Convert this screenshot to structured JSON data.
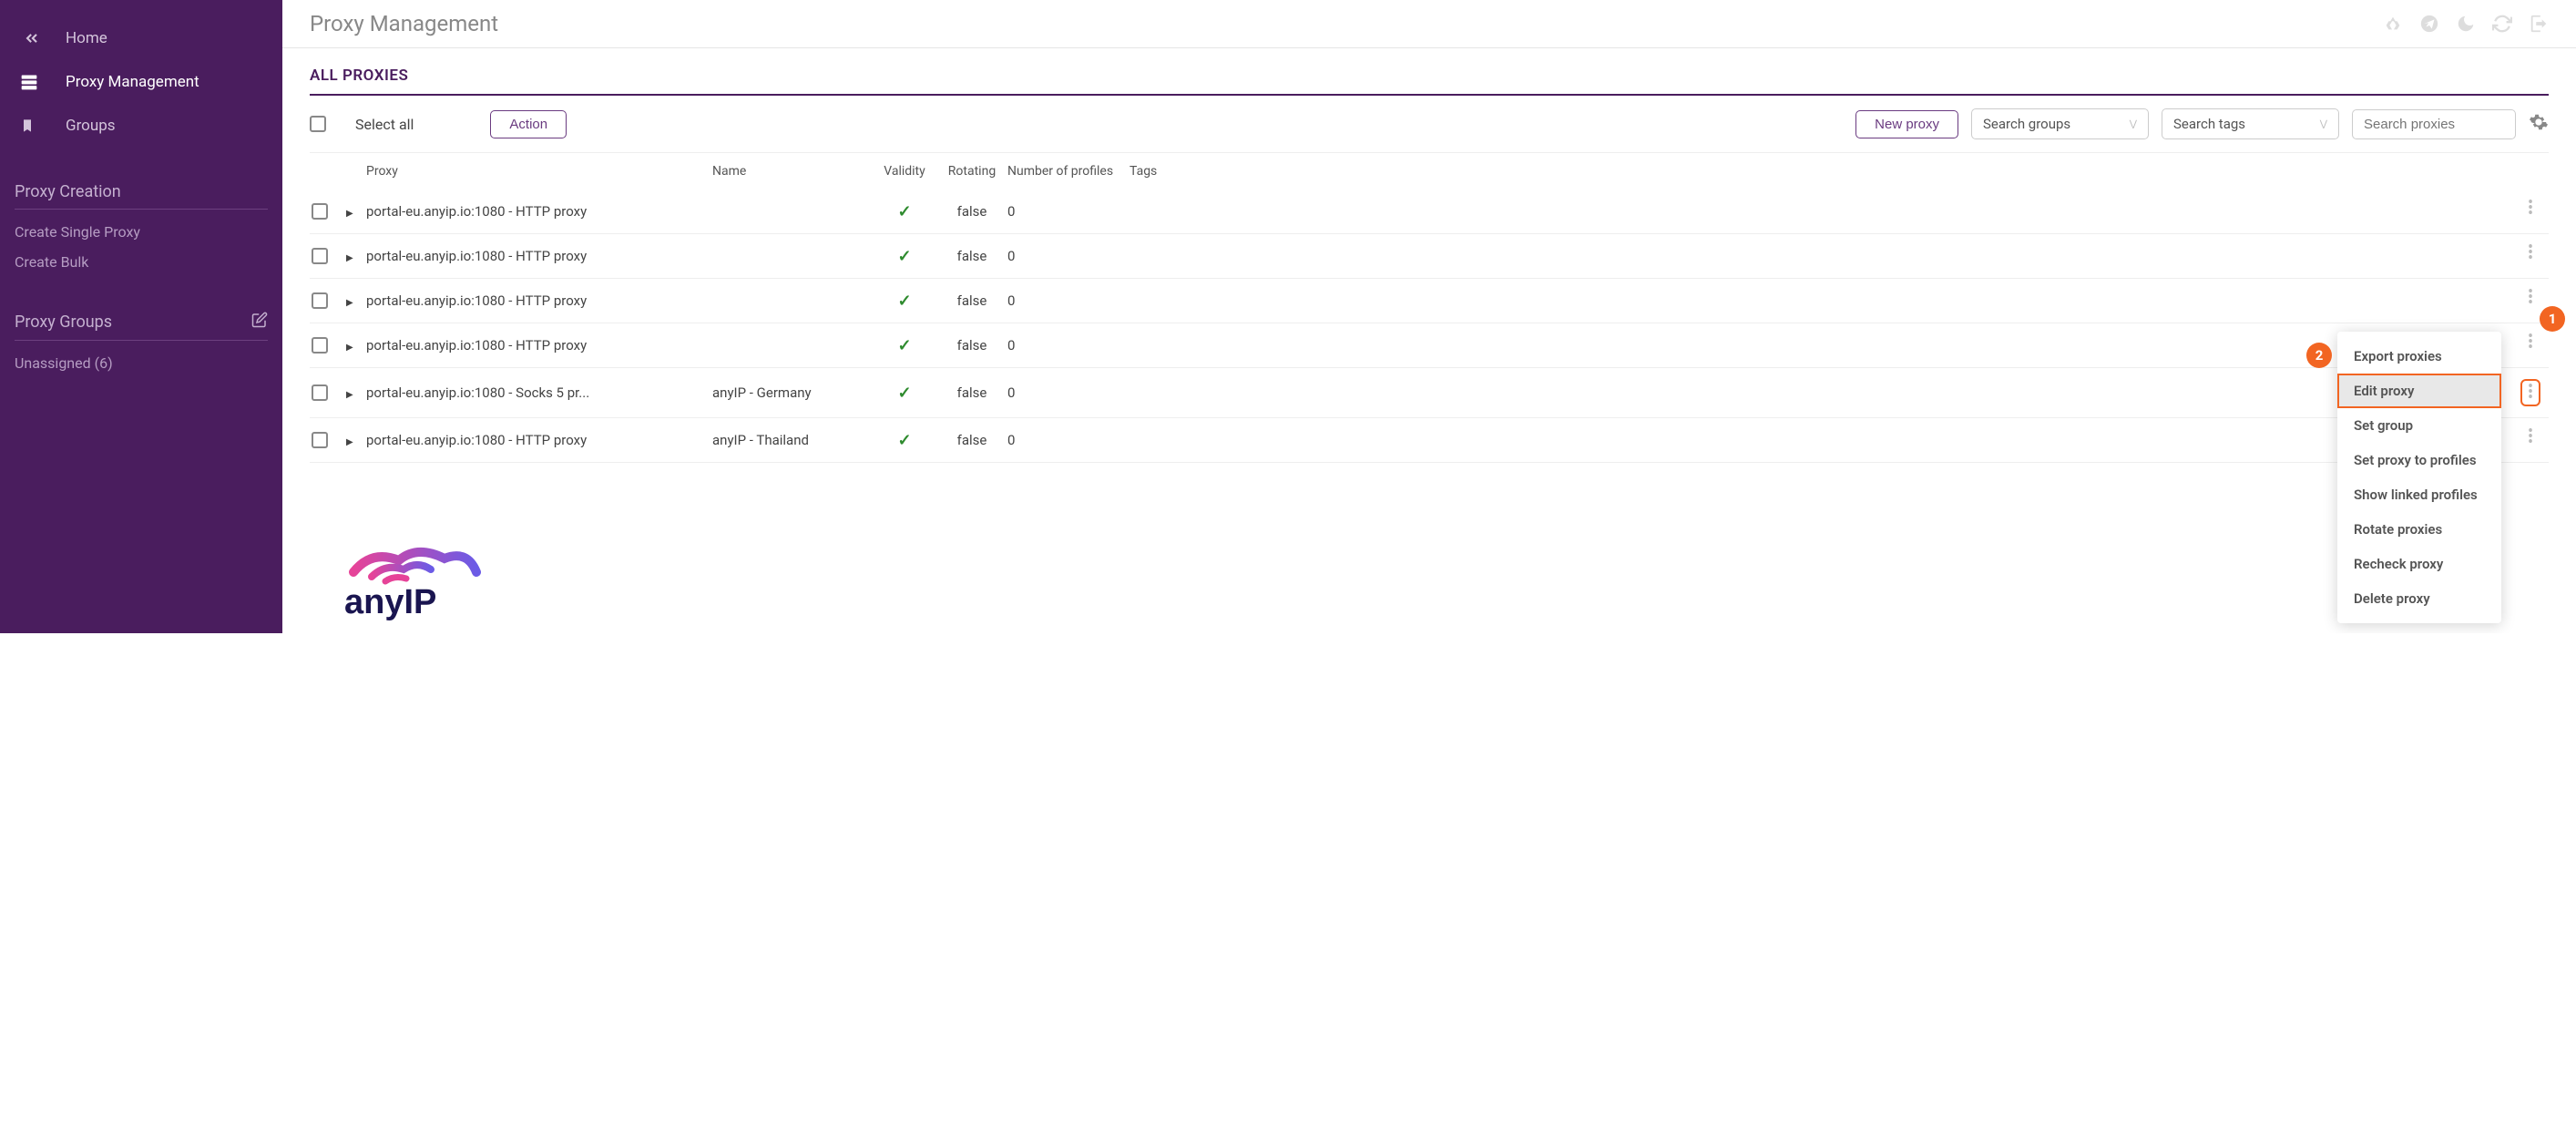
{
  "sidebar": {
    "nav": [
      {
        "label": "Home",
        "icon": "chevrons-left"
      },
      {
        "label": "Proxy Management",
        "icon": "server"
      },
      {
        "label": "Groups",
        "icon": "bookmark"
      }
    ],
    "proxyCreation": {
      "title": "Proxy Creation",
      "links": [
        "Create Single Proxy",
        "Create Bulk"
      ]
    },
    "proxyGroups": {
      "title": "Proxy Groups",
      "links": [
        "Unassigned (6)"
      ]
    }
  },
  "header": {
    "title": "Proxy Management"
  },
  "section": {
    "title": "ALL PROXIES"
  },
  "toolbar": {
    "selectAll": "Select all",
    "actionBtn": "Action",
    "newProxyBtn": "New proxy",
    "searchGroups": "Search groups",
    "searchTags": "Search tags",
    "searchProxies": "Search proxies"
  },
  "columns": {
    "proxy": "Proxy",
    "name": "Name",
    "validity": "Validity",
    "rotating": "Rotating",
    "profiles": "Number of profiles",
    "tags": "Tags"
  },
  "rows": [
    {
      "proxy": "portal-eu.anyip.io:1080 - HTTP proxy",
      "name": "",
      "valid": true,
      "rotating": "false",
      "profiles": "0"
    },
    {
      "proxy": "portal-eu.anyip.io:1080 - HTTP proxy",
      "name": "",
      "valid": true,
      "rotating": "false",
      "profiles": "0"
    },
    {
      "proxy": "portal-eu.anyip.io:1080 - HTTP proxy",
      "name": "",
      "valid": true,
      "rotating": "false",
      "profiles": "0"
    },
    {
      "proxy": "portal-eu.anyip.io:1080 - HTTP proxy",
      "name": "",
      "valid": true,
      "rotating": "false",
      "profiles": "0"
    },
    {
      "proxy": "portal-eu.anyip.io:1080 - Socks 5 pr...",
      "name": "anyIP - Germany",
      "valid": true,
      "rotating": "false",
      "profiles": "0"
    },
    {
      "proxy": "portal-eu.anyip.io:1080 - HTTP proxy",
      "name": "anyIP - Thailand",
      "valid": true,
      "rotating": "false",
      "profiles": "0"
    }
  ],
  "contextMenu": {
    "items": [
      "Export proxies",
      "Edit proxy",
      "Set group",
      "Set proxy to profiles",
      "Show linked profiles",
      "Rotate proxies",
      "Recheck proxy",
      "Delete proxy"
    ],
    "highlightedIndex": 1
  },
  "callouts": {
    "one": "1",
    "two": "2"
  }
}
